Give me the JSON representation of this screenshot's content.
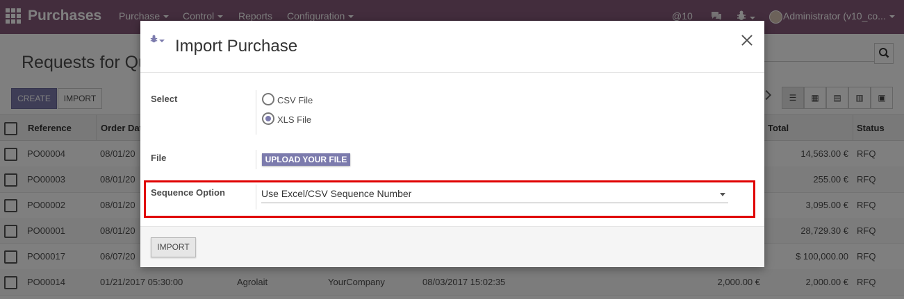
{
  "navbar": {
    "app_name": "Purchases",
    "menus": [
      "Purchase",
      "Control",
      "Reports",
      "Configuration"
    ],
    "mentions": "@10",
    "user": "Administrator (v10_co..."
  },
  "page": {
    "title_partial": "Requests for Qu",
    "create_label": "CREATE",
    "import_label": "IMPORT"
  },
  "table": {
    "headers": {
      "reference": "Reference",
      "order_date": "Order Dat",
      "total": "Total",
      "status": "Status"
    },
    "rows": [
      {
        "reference": "PO00004",
        "order_date": "08/01/20",
        "total": "14,563.00 €",
        "status": "RFQ"
      },
      {
        "reference": "PO00003",
        "order_date": "08/01/20",
        "total": "255.00 €",
        "status": "RFQ"
      },
      {
        "reference": "PO00002",
        "order_date": "08/01/20",
        "total": "3,095.00 €",
        "status": "RFQ"
      },
      {
        "reference": "PO00001",
        "order_date": "08/01/20",
        "total": "28,729.30 €",
        "status": "RFQ"
      },
      {
        "reference": "PO00017",
        "order_date": "06/07/20",
        "total": "$ 100,000.00",
        "status": "RFQ"
      },
      {
        "reference": "PO00014",
        "order_date": "01/21/2017 05:30:00",
        "vendor": "Agrolait",
        "company": "YourCompany",
        "scheduled": "08/03/2017 15:02:35",
        "untaxed": "2,000.00 €",
        "total": "2,000.00 €",
        "status": "RFQ"
      }
    ]
  },
  "modal": {
    "title": "Import Purchase",
    "select_label": "Select",
    "options": [
      "CSV File",
      "XLS File"
    ],
    "selected_option": "XLS File",
    "file_label": "File",
    "upload_label": "UPLOAD YOUR FILE",
    "sequence_label": "Sequence Option",
    "sequence_value": "Use Excel/CSV Sequence Number",
    "import_label": "IMPORT"
  },
  "colors": {
    "brand": "#875a7b",
    "accent": "#7c7bad",
    "highlight": "#e00000"
  }
}
